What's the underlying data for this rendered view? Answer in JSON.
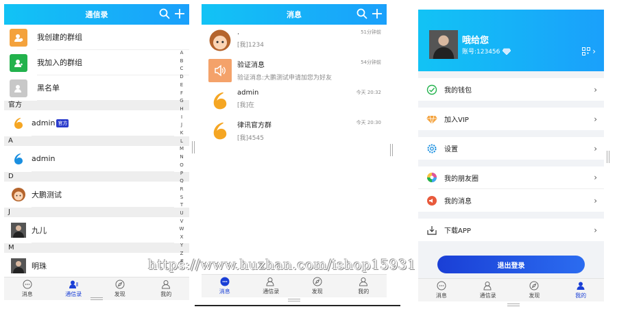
{
  "contacts": {
    "title": "通信录",
    "groups": [
      {
        "label": "我创建的群组",
        "icon": "group-create-icon",
        "color": "#f4a23c"
      },
      {
        "label": "我加入的群组",
        "icon": "group-join-icon",
        "color": "#22b24c"
      },
      {
        "label": "黑名单",
        "icon": "blacklist-icon",
        "color": "#c8c8c8"
      }
    ],
    "sections": [
      {
        "header": "官方",
        "name": "admin",
        "badge": "官方",
        "avatar": "logo-orange-icon"
      },
      {
        "header": "A",
        "name": "admin",
        "avatar": "logo-blue-icon"
      },
      {
        "header": "D",
        "name": "大鹏测试",
        "avatar": "cartoon-girl-avatar"
      },
      {
        "header": "J",
        "name": "九儿",
        "avatar": "photo-man-avatar"
      },
      {
        "header": "M",
        "name": "明珠",
        "avatar": "photo-man-avatar"
      }
    ],
    "alphabet": [
      "A",
      "B",
      "C",
      "D",
      "E",
      "F",
      "G",
      "H",
      "I",
      "J",
      "K",
      "L",
      "M",
      "N",
      "O",
      "P",
      "Q",
      "R",
      "S",
      "T",
      "U",
      "V",
      "W",
      "X",
      "Y",
      "Z",
      "#"
    ]
  },
  "messages": {
    "title": "消息",
    "items": [
      {
        "name": ".",
        "time": "51分钟前",
        "preview": "[我]1234",
        "avatar": "cartoon-girl-avatar"
      },
      {
        "name": "验证消息",
        "time": "54分钟前",
        "preview": "验证消息:大鹏测试申请加您为好友",
        "avatar": "speaker-icon"
      },
      {
        "name": "admin",
        "time": "今天 20:32",
        "preview": "[我]在",
        "avatar": "logo-orange-icon"
      },
      {
        "name": "律讯官方群",
        "time": "今天 20:30",
        "preview": "[我]4545",
        "avatar": "logo-orange-icon"
      }
    ]
  },
  "profile": {
    "greeting": "哦给您",
    "account": "账号:123456",
    "menu": [
      {
        "label": "我的钱包",
        "icon": "wallet-icon",
        "color": "#22b24c"
      },
      {
        "label": "加入VIP",
        "icon": "vip-diamond-icon",
        "color": "#f4a23c"
      },
      {
        "label": "设置",
        "icon": "gear-icon",
        "color": "#1a8fe0"
      },
      {
        "label": "我的朋友圈",
        "icon": "moments-icon",
        "color": "#e0559a"
      },
      {
        "label": "我的消息",
        "icon": "message-icon",
        "color": "#e85a3c"
      },
      {
        "label": "下载APP",
        "icon": "download-icon",
        "color": "#333333"
      }
    ],
    "logout": "退出登录"
  },
  "tabs": [
    "消息",
    "通信录",
    "发现",
    "我的"
  ],
  "watermark": "https://www.huzhan.com/ishop15931",
  "colors": {
    "header_start": "#12c3f5",
    "header_end": "#1aa0fb",
    "tab_active": "#1a3fd6",
    "logout_button": "#1a3fd6"
  }
}
